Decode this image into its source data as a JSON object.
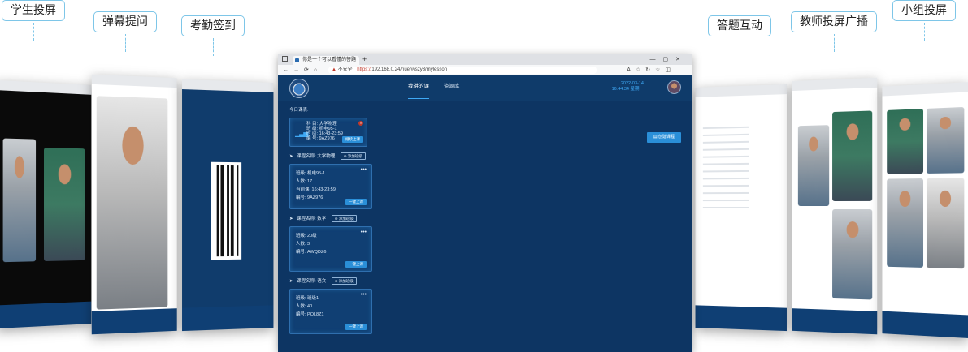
{
  "features": [
    {
      "label": "学生投屏"
    },
    {
      "label": "弹幕提问"
    },
    {
      "label": "考勤签到"
    },
    {
      "label": "答题互动"
    },
    {
      "label": "教师投屏广播"
    },
    {
      "label": "小组投屏"
    }
  ],
  "browser": {
    "tab_title": "你是一个可以看懂的答题",
    "security_label": "不安全",
    "url_host": "https://",
    "url_path": "192.168.0.24/nue/#/szy3/mylesson"
  },
  "app": {
    "nav": [
      "我讲的课",
      "资源库"
    ],
    "date": "2022-03-14",
    "time_day": "16:44:34 星期一"
  },
  "today": {
    "title": "今日课表:",
    "subject": "科  目:  大学物理",
    "class": "班  级:  机电95-1",
    "time": "时  间:  16:43-23:59",
    "code": "编  号:  9AZ976",
    "button": "继续上课"
  },
  "create_button": "创建课程",
  "add_group_label": "⊕ 添加班级",
  "courses": [
    {
      "title": "课程名称:  大学物理",
      "rows": [
        "班级:  机电95-1",
        "人数:  17",
        "当前课:  16:43-23:59",
        "编号:  9AZ976"
      ],
      "button": "一键上课"
    },
    {
      "title": "课程名称:  数学",
      "rows": [
        "班级:  20级",
        "人数:  3",
        "编号:  AWQDZ6"
      ],
      "button": "一键上课"
    },
    {
      "title": "课程名称:  语文",
      "rows": [
        "班级:  班级1",
        "人数:  40",
        "编号:  PQL8Z1"
      ],
      "button": "一键上课"
    }
  ]
}
